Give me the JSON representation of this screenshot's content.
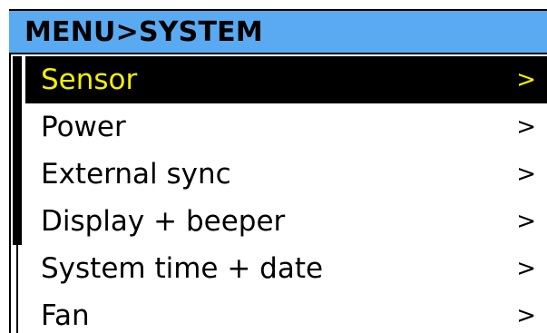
{
  "header": {
    "title": "MENU>SYSTEM"
  },
  "menu": {
    "chevron": ">",
    "selected_index": 0,
    "items": [
      {
        "label": "Sensor",
        "selected": true
      },
      {
        "label": "Power",
        "selected": false
      },
      {
        "label": "External sync",
        "selected": false
      },
      {
        "label": "Display + beeper",
        "selected": false
      },
      {
        "label": "System time + date",
        "selected": false
      },
      {
        "label": "Fan",
        "selected": false
      }
    ]
  },
  "colors": {
    "header_bg": "#5aaaf1",
    "selected_bg": "#000000",
    "selected_text": "#f3f000",
    "text": "#000000",
    "background": "#ffffff"
  }
}
